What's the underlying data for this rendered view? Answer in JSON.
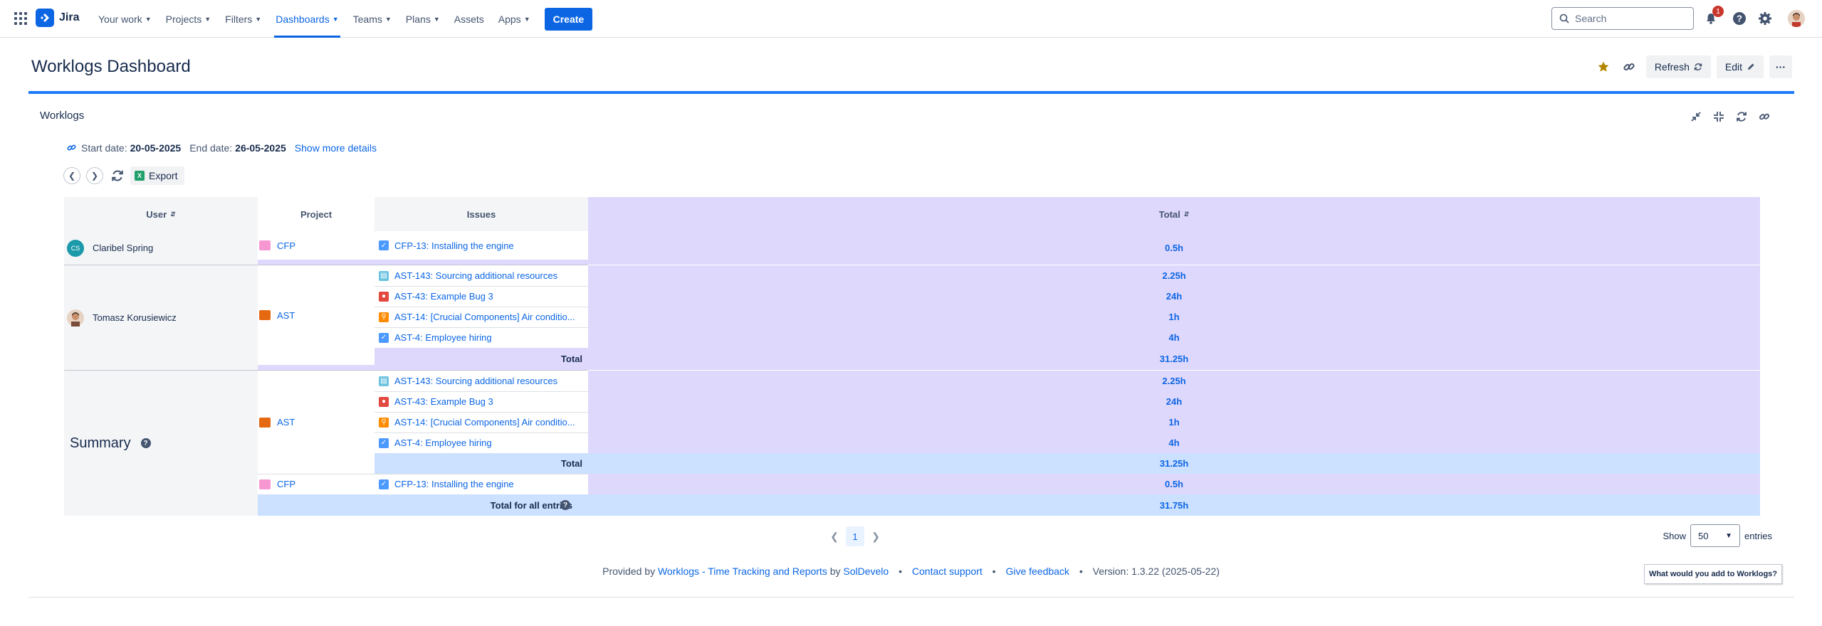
{
  "nav": {
    "logo": "Jira",
    "items": [
      {
        "label": "Your work",
        "chevron": true
      },
      {
        "label": "Projects",
        "chevron": true
      },
      {
        "label": "Filters",
        "chevron": true
      },
      {
        "label": "Dashboards",
        "chevron": true,
        "active": true
      },
      {
        "label": "Teams",
        "chevron": true
      },
      {
        "label": "Plans",
        "chevron": true
      },
      {
        "label": "Assets",
        "chevron": false
      },
      {
        "label": "Apps",
        "chevron": true
      }
    ],
    "create": "Create",
    "search_placeholder": "Search",
    "notification_count": "1"
  },
  "page": {
    "title": "Worklogs Dashboard",
    "refresh": "Refresh",
    "edit": "Edit",
    "more": "···"
  },
  "gadget": {
    "title": "Worklogs",
    "start_label": "Start date:",
    "start_date": "20-05-2025",
    "end_label": "End date:",
    "end_date": "26-05-2025",
    "show_more": "Show more details",
    "export": "Export"
  },
  "table": {
    "headers": {
      "user": "User",
      "project": "Project",
      "issues": "Issues",
      "total": "Total"
    },
    "users": [
      {
        "name": "Claribel Spring",
        "initials": "CS"
      },
      {
        "name": "Tomasz Korusiewicz"
      }
    ],
    "projects": {
      "cfp": "CFP",
      "ast": "AST"
    },
    "issues": {
      "cfp13": "CFP-13: Installing the engine",
      "ast143": "AST-143: Sourcing additional resources",
      "ast43": "AST-43: Example Bug 3",
      "ast14": "AST-14: [Crucial Components] Air conditio...",
      "ast4": "AST-4: Employee hiring"
    },
    "values": {
      "cfp13": "0.5h",
      "ast143": "2.25h",
      "ast43": "24h",
      "ast14": "1h",
      "ast4": "4h",
      "ast_total": "31.25h",
      "grand_total": "31.75h"
    },
    "total_label": "Total",
    "summary_label": "Summary",
    "total_all_label": "Total for all entries"
  },
  "pagination": {
    "page": "1",
    "show": "Show",
    "entries_value": "50",
    "entries": "entries"
  },
  "footer": {
    "provided_by": "Provided by",
    "app_link": "Worklogs - Time Tracking and Reports",
    "by": "by",
    "vendor": "SolDevelo",
    "contact": "Contact support",
    "feedback": "Give feedback",
    "version": "Version: 1.3.22 (2025-05-22)"
  },
  "feedback_button": "What would you add to Worklogs?",
  "colors": {
    "accent": "#0c66e4",
    "user_total_bg": "#dfd8fd",
    "summary_total_bg": "#cce0ff",
    "avatar_cs": "#1d9aaa"
  }
}
